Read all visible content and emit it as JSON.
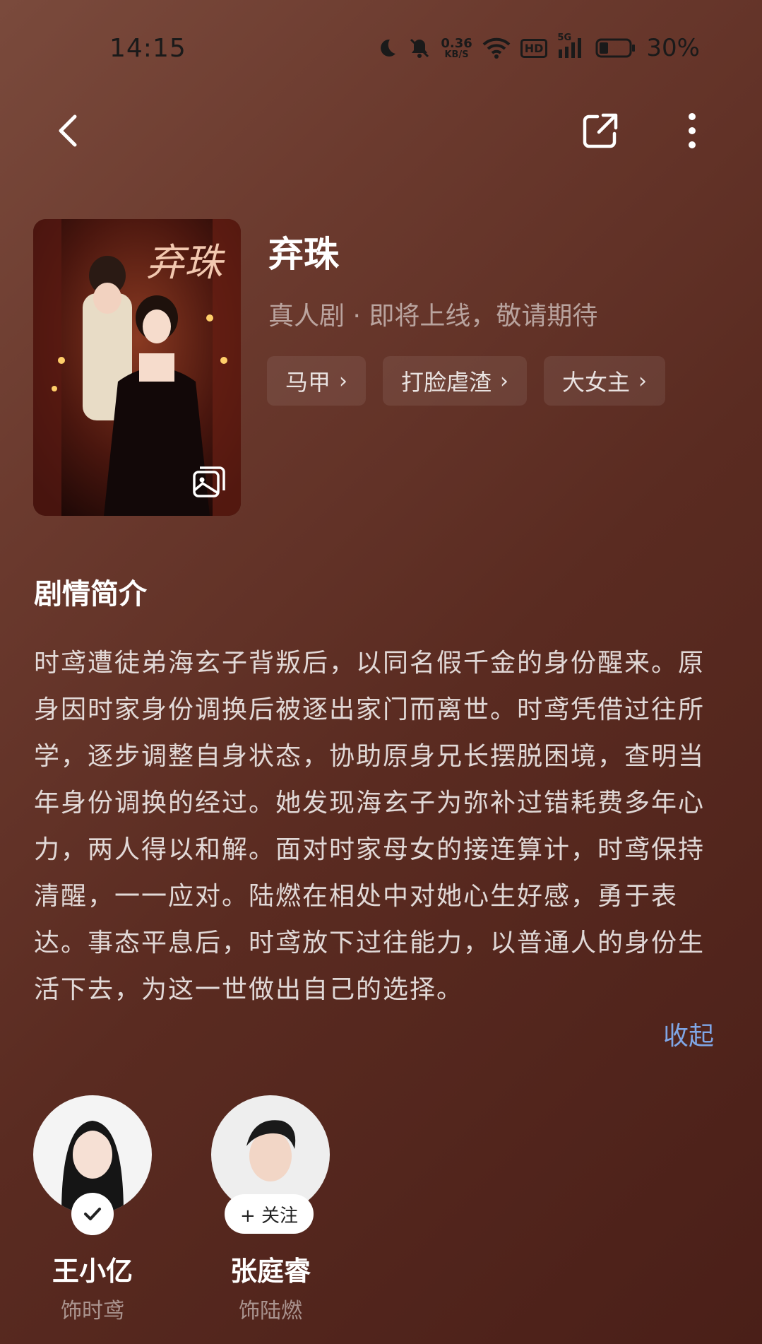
{
  "status_bar": {
    "time": "14:15",
    "net_speed_value": "0.36",
    "net_speed_unit": "KB/S",
    "hd_label": "HD",
    "network_label": "5G",
    "battery_percent": "30%",
    "battery_level": 0.3
  },
  "nav": {
    "back_icon": "chevron-left-icon",
    "share_icon": "share-icon",
    "more_icon": "more-vertical-icon"
  },
  "show": {
    "title": "弃珠",
    "meta": "真人剧 · 即将上线，敬请期待",
    "tags": [
      {
        "label": "马甲"
      },
      {
        "label": "打脸虐渣"
      },
      {
        "label": "大女主"
      }
    ]
  },
  "synopsis": {
    "section_title": "剧情简介",
    "text": "时鸢遭徒弟海玄子背叛后，以同名假千金的身份醒来。原身因时家身份调换后被逐出家门而离世。时鸢凭借过往所学，逐步调整自身状态，协助原身兄长摆脱困境，查明当年身份调换的经过。她发现海玄子为弥补过错耗费多年心力，两人得以和解。面对时家母女的接连算计，时鸢保持清醒，一一应对。陆燃在相处中对她心生好感，勇于表达。事态平息后，时鸢放下过往能力，以普通人的身份生活下去，为这一世做出自己的选择。",
    "collapse_label": "收起"
  },
  "cast": [
    {
      "name": "王小亿",
      "role": "饰时鸢",
      "followed": true
    },
    {
      "name": "张庭睿",
      "role": "饰陆燃",
      "followed": false,
      "follow_label": "+ 关注"
    }
  ],
  "colors": {
    "link": "#7fa6e6",
    "background": "#5a2b21"
  }
}
